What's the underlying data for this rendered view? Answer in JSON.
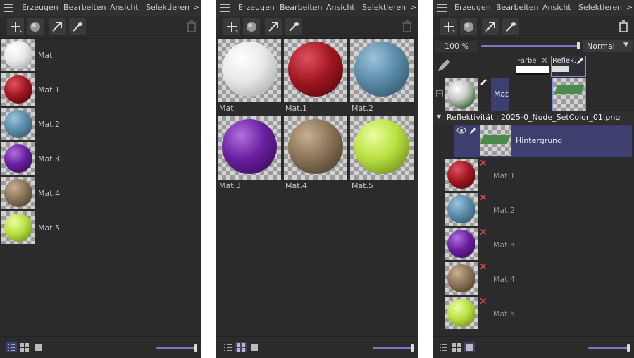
{
  "menu": {
    "items": [
      "Erzeugen",
      "Bearbeiten",
      "Ansicht",
      "Selektieren"
    ],
    "more": ">"
  },
  "materials": [
    {
      "name": "Mat",
      "color": "#e8e8e8"
    },
    {
      "name": "Mat.1",
      "color": "#a01822"
    },
    {
      "name": "Mat.2",
      "color": "#5a8ba8"
    },
    {
      "name": "Mat.3",
      "color": "#6a1fa0"
    },
    {
      "name": "Mat.4",
      "color": "#8a7358"
    },
    {
      "name": "Mat.5",
      "color": "#b8e040"
    }
  ],
  "layer_panel": {
    "opacity": "100 %",
    "blend_mode": "Normal",
    "channel_farbe": "Farbe",
    "channel_reflek": "Reflek.",
    "active_material": "Mat",
    "section_title": "Reflektivität : 2025-0_Node_SetColor_01.png",
    "layer_name": "Hintergrund"
  },
  "colors": {
    "panel_bg": "#2b2b2b",
    "accent": "#3d3f6e",
    "slider": "#7a7ac8",
    "x_red": "#e05050"
  }
}
